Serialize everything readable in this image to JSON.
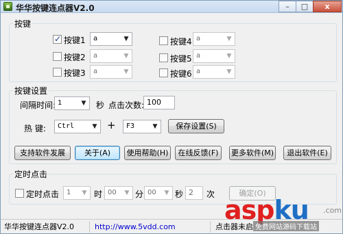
{
  "window": {
    "title": "华华按键连点器V2.0",
    "minimize": "–",
    "maximize": "□",
    "close": "x"
  },
  "keys_group": {
    "label": "按键",
    "keys": [
      {
        "label": "按键1",
        "checked": true,
        "value": "a"
      },
      {
        "label": "按键2",
        "checked": false,
        "value": "a"
      },
      {
        "label": "按键3",
        "checked": false,
        "value": "a"
      },
      {
        "label": "按键4",
        "checked": false,
        "value": "a"
      },
      {
        "label": "按键5",
        "checked": false,
        "value": "a"
      },
      {
        "label": "按键6",
        "checked": false,
        "value": "a"
      }
    ]
  },
  "settings_group": {
    "label": "按键设置",
    "interval_label": "间隔时间:",
    "interval_value": "1",
    "seconds_label": "秒",
    "click_count_label": "点击次数:",
    "click_count_value": "100",
    "hotkey_label": "热  键:",
    "hotkey_modifier": "Ctrl",
    "plus": "+",
    "hotkey_key": "F3",
    "save_button": "保存设置(S)"
  },
  "action_buttons": {
    "support": "支持软件发展",
    "about": "关于(A)",
    "help": "使用帮助(H)",
    "feedback": "在线反馈(F)",
    "more": "更多软件(M)",
    "exit": "退出软件(E)"
  },
  "timer_group": {
    "label": "定时点击",
    "checkbox_label": "定时点击",
    "checked": false,
    "hour_value": "1",
    "hour_label": "时",
    "minute_value": "00",
    "minute_label": "分",
    "second_value": "00",
    "second_label": "秒",
    "times_value": "2",
    "times_label": "次",
    "confirm_button": "确定(O)"
  },
  "statusbar": {
    "app_name": "华华按键连点器V2.0",
    "url": "http://www.5vdd.com",
    "status": "点击器未启"
  },
  "watermark": {
    "text_red": "asp",
    "text_blue": "ku",
    "suffix": ".com",
    "sub": "免费网站源码下载站"
  },
  "colors": {
    "accent_blue": "#1f6fc4",
    "accent_red": "#e02020",
    "link": "#0000cc"
  }
}
